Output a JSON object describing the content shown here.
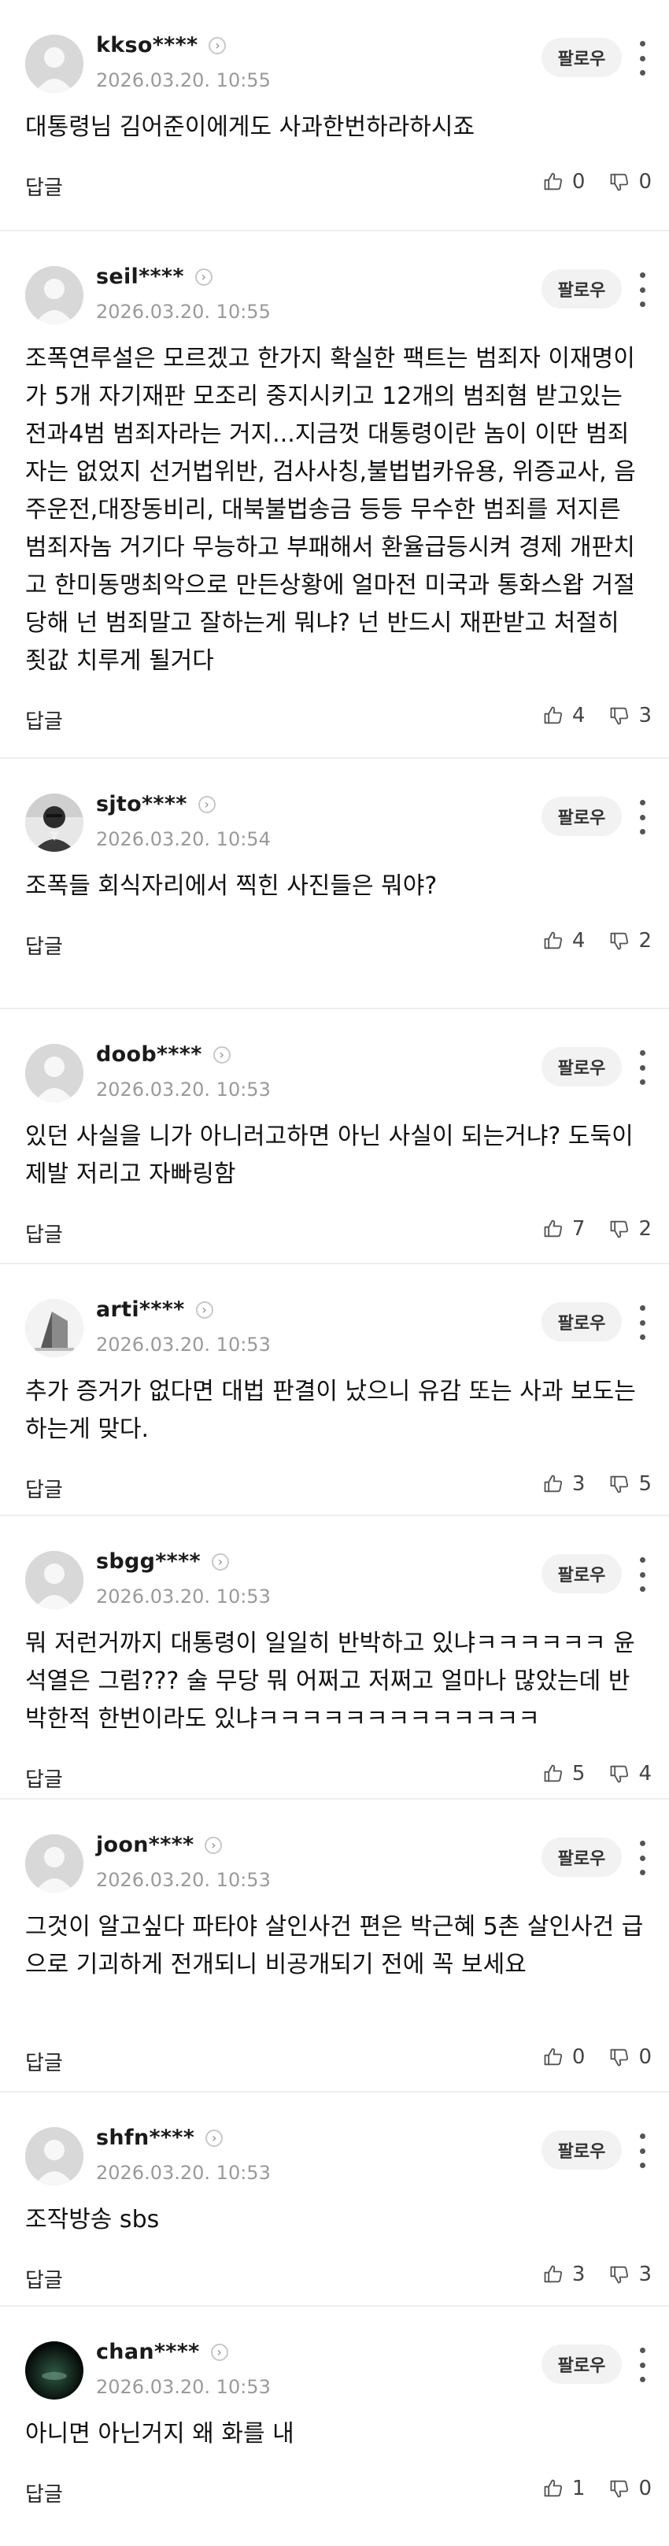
{
  "ui": {
    "follow_label": "팔로우",
    "reply_label": "답글"
  },
  "comments": [
    {
      "username": "kkso****",
      "date": "2026.03.20. 10:55",
      "avatar": "default",
      "body": "대통령님 김어준이에게도 사과한번하라하시죠",
      "likes": "0",
      "dislikes": "0"
    },
    {
      "username": "seil****",
      "date": "2026.03.20. 10:55",
      "avatar": "default",
      "body": "조폭연루설은 모르겠고 한가지 확실한 팩트는 범죄자 이재명이가 5개 자기재판 모조리 중지시키고 12개의 범죄혐 받고있는 전과4범 범죄자라는 거지...지금껏 대통령이란 놈이 이딴 범죄자는 없었지 선거법위반, 검사사칭,불법법카유용, 위증교사, 음주운전,대장동비리, 대북불법송금 등등 무수한 범죄를 저지른 범죄자놈 거기다 무능하고 부패해서 환율급등시켜 경제 개판치고 한미동맹최악으로 만든상황에 얼마전 미국과 통화스왑 거절 당해 넌 범죄말고 잘하는게 뭐냐? 넌 반드시 재판받고 처절히 죗값 치루게 될거다",
      "likes": "4",
      "dislikes": "3"
    },
    {
      "username": "sjto****",
      "date": "2026.03.20. 10:54",
      "avatar": "photo-person",
      "body": "조폭들 회식자리에서 찍힌 사진들은 뭐야?",
      "likes": "4",
      "dislikes": "2"
    },
    {
      "username": "doob****",
      "date": "2026.03.20. 10:53",
      "avatar": "default",
      "body": "있던 사실을 니가 아니러고하면 아닌 사실이 되는거냐? 도둑이 제발 저리고 자빠링함",
      "likes": "7",
      "dislikes": "2"
    },
    {
      "username": "arti****",
      "date": "2026.03.20. 10:53",
      "avatar": "photo-building",
      "body": "추가 증거가 없다면 대법 판결이 났으니 유감 또는 사과 보도는 하는게 맞다.",
      "likes": "3",
      "dislikes": "5"
    },
    {
      "username": "sbgg****",
      "date": "2026.03.20. 10:53",
      "avatar": "default",
      "body": "뭐 저런거까지 대통령이 일일히 반박하고 있냐ㅋㅋㅋㅋㅋㅋ 윤석열은 그럼??? 술 무당 뭐 어쩌고 저쩌고 얼마나 많았는데 반박한적 한번이라도 있냐ㅋㅋㅋㅋㅋㅋㅋㅋㅋㅋㅋㅋㅋ",
      "likes": "5",
      "dislikes": "4"
    },
    {
      "username": "joon****",
      "date": "2026.03.20. 10:53",
      "avatar": "default",
      "body": "그것이 알고싶다 파타야 살인사건 편은 박근혜 5촌 살인사건 급으로 기괴하게 전개되니 비공개되기 전에 꼭 보세요",
      "likes": "0",
      "dislikes": "0"
    },
    {
      "username": "shfn****",
      "date": "2026.03.20. 10:53",
      "avatar": "default",
      "body": "조작방송 sbs",
      "likes": "3",
      "dislikes": "3"
    },
    {
      "username": "chan****",
      "date": "2026.03.20. 10:53",
      "avatar": "photo-dark",
      "body": "아니면 아닌거지 왜 화를 내",
      "likes": "1",
      "dislikes": "0"
    }
  ]
}
